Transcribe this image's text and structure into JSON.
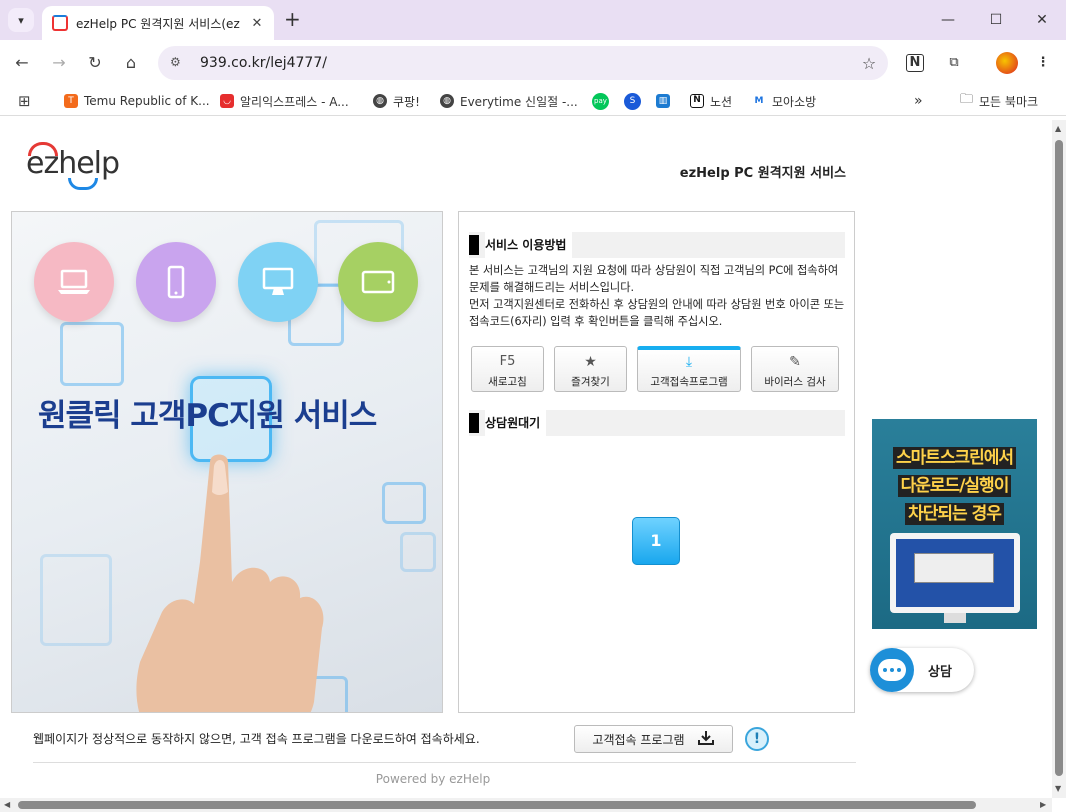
{
  "browser": {
    "tab_title": "ezHelp PC 원격지원 서비스(ez",
    "url": "939.co.kr/lej4777/",
    "bookmarks": [
      {
        "label": "Temu Republic of K...",
        "color": "#f36b1c"
      },
      {
        "label": "알리익스프레스 - A...",
        "color": "#e62e2e"
      },
      {
        "label": "쿠팡!",
        "color": "#444444"
      },
      {
        "label": "Everytime 신일절 -...",
        "color": "#444444"
      },
      {
        "label": "",
        "color": "#03c75a"
      },
      {
        "label": "",
        "color": "#1a5ad8"
      },
      {
        "label": "",
        "color": "#1d7bd1"
      },
      {
        "label": "노션",
        "color": "#111111"
      },
      {
        "label": "모아소방",
        "color": "#1d74e0"
      }
    ],
    "all_bookmarks": "모든 북마크"
  },
  "header": {
    "logo": "ezhelp",
    "title": "ezHelp PC 원격지원 서비스"
  },
  "hero": {
    "text": "원클릭 고객PC지원 서비스"
  },
  "panel": {
    "usage_title": "서비스 이용방법",
    "usage_desc_1": "본 서비스는 고객님의 지원 요청에 따라 상담원이 직접 고객님의 PC에 접속하여 문제를 해결해드리는 서비스입니다.",
    "usage_desc_2": "먼저 고객지원센터로 전화하신 후 상담원의 안내에 따라 상담원 번호 아이콘 또는 접속코드(6자리) 입력 후 확인버튼을 클릭해 주십시오.",
    "buttons": [
      {
        "icon": "F5",
        "label": "새로고침"
      },
      {
        "icon": "★",
        "label": "즐겨찾기"
      },
      {
        "icon": "⤓",
        "label": "고객접속프로그램"
      },
      {
        "icon": "✎",
        "label": "바이러스 검사"
      }
    ],
    "waiting_title": "상담원대기",
    "counselor_number": "1"
  },
  "banner": {
    "line1": "스마트스크린에서",
    "line2": "다운로드/실행이",
    "line3": "차단되는 경우"
  },
  "chat": {
    "label": "상담"
  },
  "footer": {
    "note": "웹페이지가 정상적으로 동작하지 않으면, 고객 접속 프로그램을 다운로드하여 접속하세요.",
    "download_label": "고객접속 프로그램",
    "info_icon": "!",
    "powered": "Powered by ezHelp"
  },
  "colors": {
    "accent": "#18aef0",
    "hero_text": "#1b3e8f",
    "banner_bg": "#2a7f9a",
    "chat": "#1d8fd8"
  }
}
